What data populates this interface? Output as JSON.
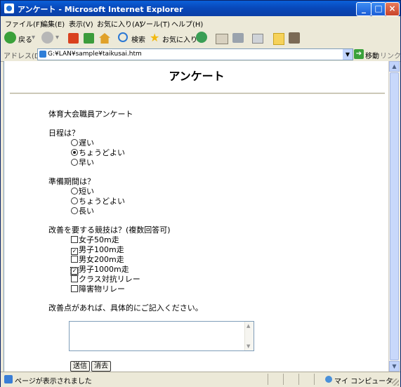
{
  "window": {
    "title": "アンケート - Microsoft Internet Explorer"
  },
  "menu": [
    "ファイル(F)",
    "編集(E)",
    "表示(V)",
    "お気に入り(A)",
    "ツール(T)",
    "ヘルプ(H)"
  ],
  "toolbar": {
    "back_label": "戻る",
    "search_label": "検索",
    "favorites_label": "お気に入り"
  },
  "address": {
    "label": "アドレス(D)",
    "url": "G:¥LAN¥sample¥taikusai.htm",
    "go_label": "移動",
    "links_label": "リンク"
  },
  "page": {
    "title": "アンケート",
    "intro": "体育大会職員アンケート",
    "q1": {
      "label": "日程は？",
      "options": [
        "遅い",
        "ちょうどよい",
        "早い"
      ],
      "selected_index": 1
    },
    "q2": {
      "label": "準備期間は？",
      "options": [
        "短い",
        "ちょうどよい",
        "長い"
      ],
      "selected_index": null
    },
    "q3": {
      "label": "改善を要する競技は？(複数回答可)",
      "options": [
        "女子50m走",
        "男子100m走",
        "男女200m走",
        "男子1000m走",
        "クラス対抗リレー",
        "障害物リレー"
      ],
      "checked": [
        false,
        true,
        false,
        true,
        false,
        false
      ]
    },
    "comment_prompt": "改善点があれば、具体的にご記入ください。",
    "comment_value": "",
    "submit_label": "送信",
    "reset_label": "消去"
  },
  "status": {
    "text": "ページが表示されました",
    "zone": "マイ コンピュータ"
  }
}
